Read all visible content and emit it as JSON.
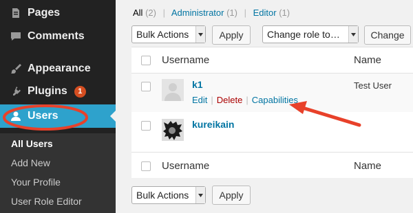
{
  "sidebar": {
    "items": [
      {
        "label": "Pages",
        "icon": "pages-icon"
      },
      {
        "label": "Comments",
        "icon": "comments-icon"
      },
      {
        "label": "Appearance",
        "icon": "appearance-icon"
      },
      {
        "label": "Plugins",
        "icon": "plugins-icon",
        "badge": "1"
      },
      {
        "label": "Users",
        "icon": "users-icon",
        "active": true
      }
    ],
    "submenu": [
      {
        "label": "All Users",
        "current": true
      },
      {
        "label": "Add New"
      },
      {
        "label": "Your Profile"
      },
      {
        "label": "User Role Editor"
      }
    ]
  },
  "filters": {
    "all": "All",
    "all_count": "(2)",
    "administrator": "Administrator",
    "administrator_count": "(1)",
    "editor": "Editor",
    "editor_count": "(1)",
    "separator": "|"
  },
  "toolbar_top": {
    "bulk_actions": "Bulk Actions",
    "apply": "Apply",
    "change_role": "Change role to…",
    "change": "Change"
  },
  "table": {
    "columns": {
      "username": "Username",
      "name": "Name"
    },
    "rows": [
      {
        "username": "k1",
        "name": "Test User",
        "actions": {
          "edit": "Edit",
          "delete": "Delete",
          "capabilities": "Capabilities"
        }
      },
      {
        "username": "kureikain",
        "name": ""
      }
    ],
    "footer_columns": {
      "username": "Username",
      "name": "Name"
    }
  },
  "toolbar_bottom": {
    "bulk_actions": "Bulk Actions",
    "apply": "Apply"
  },
  "colors": {
    "sidebar_bg": "#222222",
    "active_bg": "#2ea2cc",
    "link": "#0074a2",
    "delete": "#aa0000",
    "annotation": "#e8412a",
    "badge": "#d54e21"
  }
}
